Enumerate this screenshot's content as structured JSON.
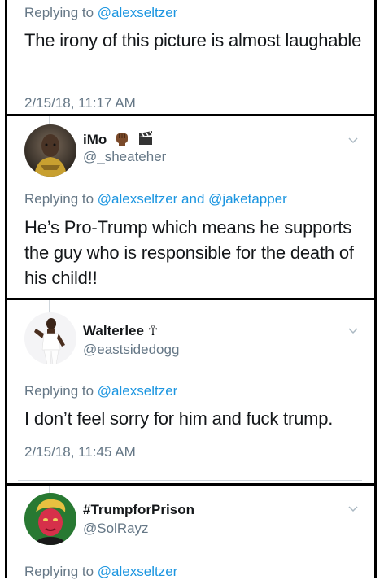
{
  "tweets": [
    {
      "reply_prefix": "Replying to",
      "mentions": [
        "@alexseltzer"
      ],
      "text": "The irony of this picture is almost laughable",
      "timestamp": "2/15/18, 11:17 AM"
    },
    {
      "name": "iMo",
      "handle": "@_sheateher",
      "reply_prefix": "Replying to",
      "mentions": [
        "@alexseltzer",
        "@jaketapper"
      ],
      "mention_joiner": "and",
      "text": "He’s Pro-Trump which means he supports the guy who is responsible for the death of his child!!"
    },
    {
      "name": "Walterlee ☥",
      "handle": "@eastsidedogg",
      "reply_prefix": "Replying to",
      "mentions": [
        "@alexseltzer"
      ],
      "text": "I don’t feel sorry for him and fuck trump.",
      "timestamp": "2/15/18, 11:45 AM"
    },
    {
      "name": "#TrumpforPrison",
      "handle": "@SolRayz",
      "reply_prefix": "Replying to",
      "mentions": [
        "@alexseltzer"
      ]
    }
  ],
  "colors": {
    "mention": "#1b95e0",
    "muted": "#657786",
    "text": "#14171a",
    "divider": "#000000"
  },
  "icons": {
    "name_badges_tweet2": [
      "raised-fist-icon",
      "clapper-board-icon"
    ],
    "menu": "chevron-down-icon"
  }
}
